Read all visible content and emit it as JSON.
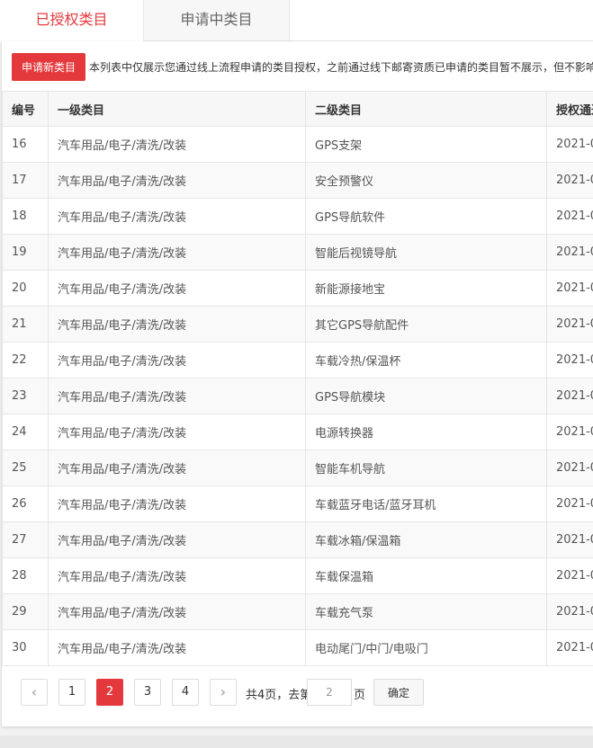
{
  "tabs": {
    "authorized": "已授权类目",
    "pending": "申请中类目"
  },
  "toolbar": {
    "apply_label": "申请新类目",
    "notice": "本列表中仅展示您通过线上流程申请的类目授权，之前通过线下邮寄资质已申请的类目暂不展示，但不影响"
  },
  "table": {
    "columns": [
      "编号",
      "一级类目",
      "二级类目",
      "授权通过时间"
    ],
    "rows": [
      {
        "id": "16",
        "level1": "汽车用品/电子/清洗/改装",
        "level2": "GPS支架",
        "date": "2021-0"
      },
      {
        "id": "17",
        "level1": "汽车用品/电子/清洗/改装",
        "level2": "安全预警仪",
        "date": "2021-0"
      },
      {
        "id": "18",
        "level1": "汽车用品/电子/清洗/改装",
        "level2": "GPS导航软件",
        "date": "2021-0"
      },
      {
        "id": "19",
        "level1": "汽车用品/电子/清洗/改装",
        "level2": "智能后视镜导航",
        "date": "2021-0"
      },
      {
        "id": "20",
        "level1": "汽车用品/电子/清洗/改装",
        "level2": "新能源接地宝",
        "date": "2021-0"
      },
      {
        "id": "21",
        "level1": "汽车用品/电子/清洗/改装",
        "level2": "其它GPS导航配件",
        "date": "2021-0"
      },
      {
        "id": "22",
        "level1": "汽车用品/电子/清洗/改装",
        "level2": "车载冷热/保温杯",
        "date": "2021-0"
      },
      {
        "id": "23",
        "level1": "汽车用品/电子/清洗/改装",
        "level2": "GPS导航模块",
        "date": "2021-0"
      },
      {
        "id": "24",
        "level1": "汽车用品/电子/清洗/改装",
        "level2": "电源转换器",
        "date": "2021-0"
      },
      {
        "id": "25",
        "level1": "汽车用品/电子/清洗/改装",
        "level2": "智能车机导航",
        "date": "2021-0"
      },
      {
        "id": "26",
        "level1": "汽车用品/电子/清洗/改装",
        "level2": "车载蓝牙电话/蓝牙耳机",
        "date": "2021-0"
      },
      {
        "id": "27",
        "level1": "汽车用品/电子/清洗/改装",
        "level2": "车载冰箱/保温箱",
        "date": "2021-0"
      },
      {
        "id": "28",
        "level1": "汽车用品/电子/清洗/改装",
        "level2": "车载保温箱",
        "date": "2021-0"
      },
      {
        "id": "29",
        "level1": "汽车用品/电子/清洗/改装",
        "level2": "车载充气泵",
        "date": "2021-0"
      },
      {
        "id": "30",
        "level1": "汽车用品/电子/清洗/改装",
        "level2": "电动尾门/中门/电吸门",
        "date": "2021-0"
      }
    ]
  },
  "pagination": {
    "prev_icon": "chevron-left-icon",
    "next_icon": "chevron-right-icon",
    "pages": [
      "1",
      "2",
      "3",
      "4"
    ],
    "current": "2",
    "total_text": "共4页，去第",
    "page_suffix": "页",
    "input_value": "2",
    "confirm_label": "确定"
  },
  "colors": {
    "accent": "#e4393c",
    "border": "#e6e6e6",
    "header_bg": "#f7f7f7"
  }
}
